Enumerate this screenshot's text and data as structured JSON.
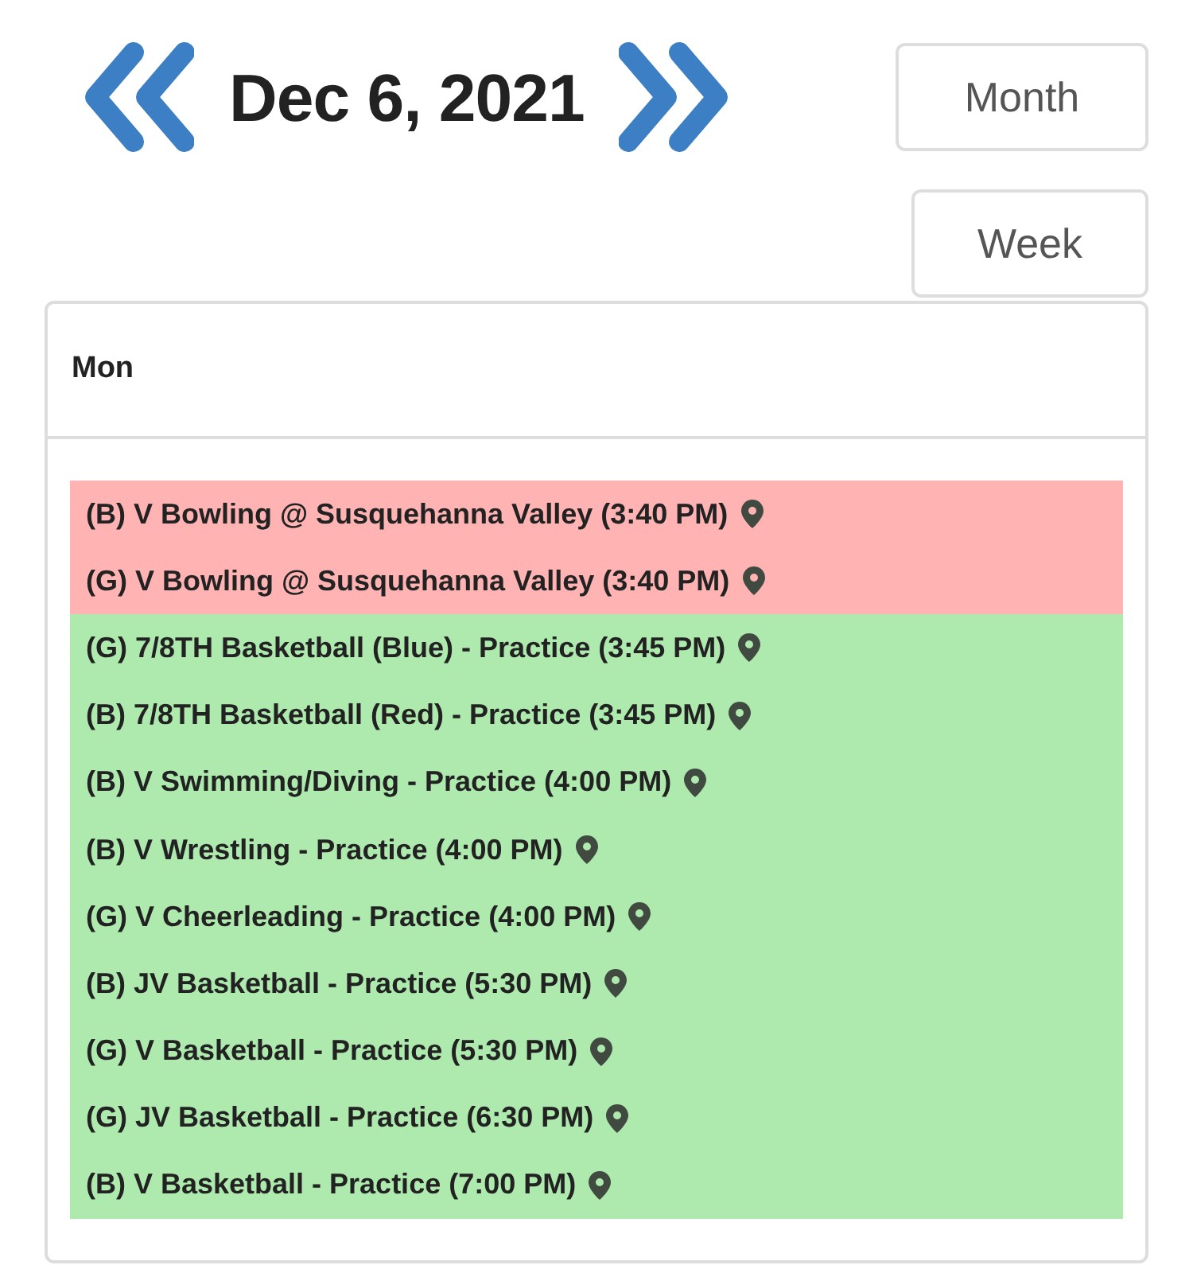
{
  "header": {
    "date": "Dec 6, 2021"
  },
  "views": [
    {
      "label": "Month"
    },
    {
      "label": "Week"
    }
  ],
  "day": {
    "label": "Mon"
  },
  "events": [
    {
      "title": "(B) V Bowling @ Susquehanna Valley (3:40 PM)",
      "color": "#ffb3b3"
    },
    {
      "title": "(G) V Bowling @ Susquehanna Valley (3:40 PM)",
      "color": "#ffb3b3"
    },
    {
      "title": "(G) 7/8TH Basketball (Blue) - Practice (3:45 PM)",
      "color": "#aeeaae"
    },
    {
      "title": "(B) 7/8TH Basketball (Red) - Practice (3:45 PM)",
      "color": "#aeeaae"
    },
    {
      "title": "(B) V Swimming/Diving - Practice (4:00 PM)",
      "color": "#aeeaae"
    },
    {
      "title": "(B) V Wrestling - Practice (4:00 PM)",
      "color": "#aeeaae"
    },
    {
      "title": "(G) V Cheerleading - Practice (4:00 PM)",
      "color": "#aeeaae"
    },
    {
      "title": "(B) JV Basketball - Practice (5:30 PM)",
      "color": "#aeeaae"
    },
    {
      "title": "(G) V Basketball - Practice (5:30 PM)",
      "color": "#aeeaae"
    },
    {
      "title": "(G) JV Basketball - Practice (6:30 PM)",
      "color": "#aeeaae"
    },
    {
      "title": "(B) V Basketball - Practice (7:00 PM)",
      "color": "#aeeaae"
    }
  ]
}
